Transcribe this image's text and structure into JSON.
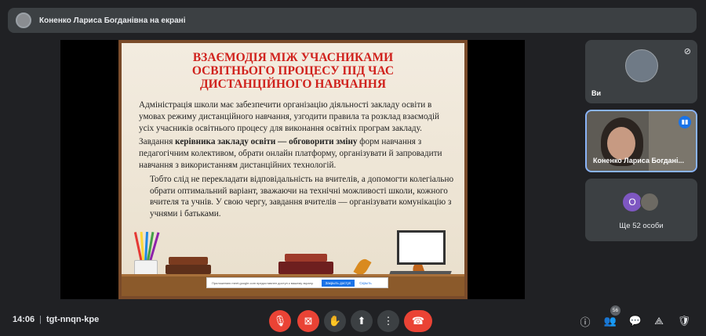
{
  "topbar": {
    "presenter_label": "Коненко Лариса Богданівна на екрані"
  },
  "slide": {
    "title_lines": [
      "ВЗАЄМОДІЯ МІЖ УЧАСНИКАМИ",
      "ОСВІТНЬОГО ПРОЦЕСУ ПІД ЧАС",
      "ДИСТАНЦІЙНОГО НАВЧАННЯ"
    ],
    "para1": "Адміністрація школи має забезпечити організацію діяльності закладу освіти в умовах режиму дистанційного навчання, узгодити правила та розклад взаємодій усіх учасників освітнього процесу для виконання освітніх програм закладу.",
    "para2_prefix": "Завдання ",
    "para2_bold1": "керівника закладу освіти — обговорити зміну",
    "para2_rest": " форм навчання з педагогічним колективом, обрати онлайн платформу, організувати й запровадити навчання з використанням дистанційних технологій.",
    "para3": "Тобто слід не перекладати відповідальність на вчителів, а допомогти колегіально обрати оптимальний варіант, зважаючи на технічні можливості школи, кожного вчителя та учнів. У свою чергу, завдання вчителів — організувати комунікацію з учнями і батьками.",
    "notice_text": "Приложению meet.google.com предоставлен доступ к вашему экрану.",
    "notice_allow": "Закрыть доступ",
    "notice_cancel": "Скрыть"
  },
  "tiles": {
    "self_name": "Ви",
    "presenter_name": "Коненко Лариса Богдані...",
    "others_initial": "О",
    "others_label": "Ще 52 особи"
  },
  "bottom": {
    "time": "14:06",
    "meeting_code": "tgt-nnqn-kpe",
    "participants_count": "56"
  },
  "colors": {
    "end_call": "#ea4335",
    "accent": "#8ab4f8",
    "slide_title": "#d0221d"
  }
}
